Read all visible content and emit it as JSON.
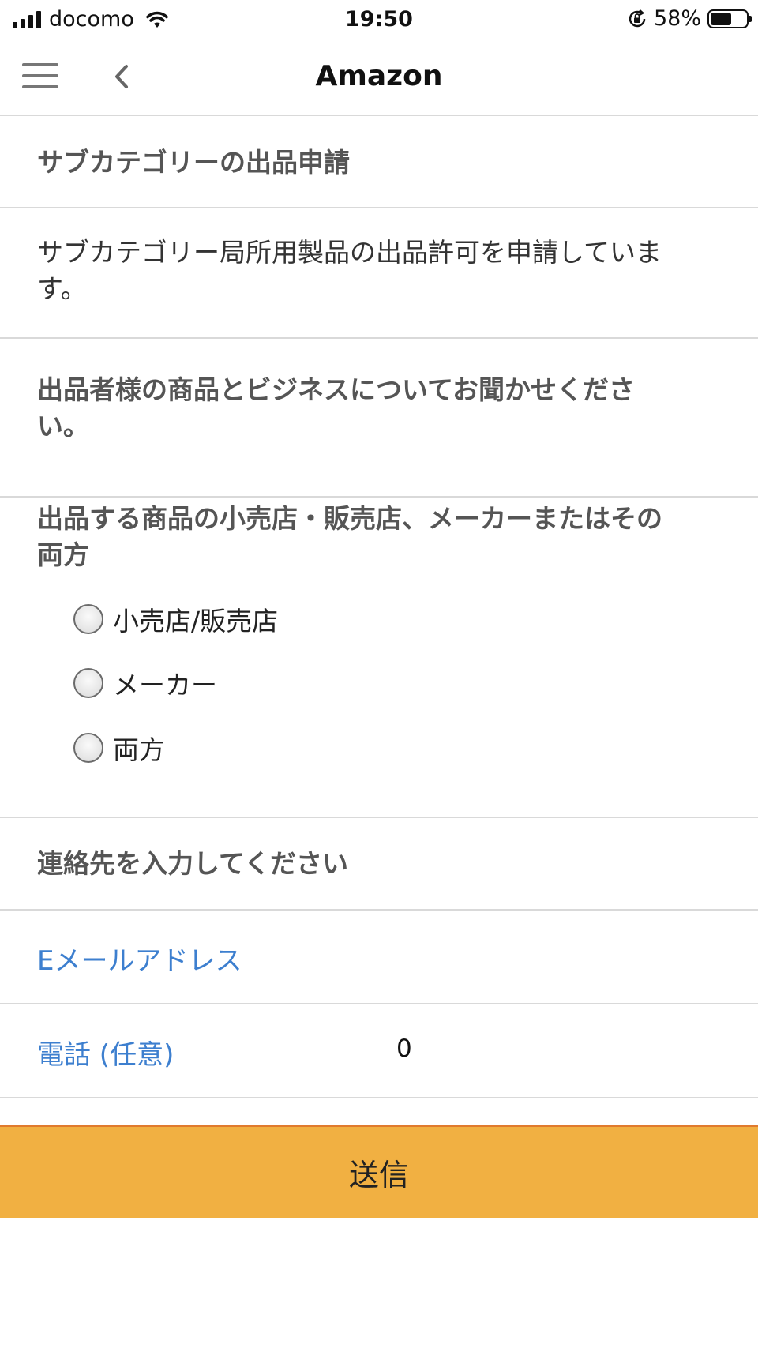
{
  "status_bar": {
    "carrier": "docomo",
    "time": "19:50",
    "battery": "58%"
  },
  "nav": {
    "title": "Amazon"
  },
  "header": {
    "title": "サブカテゴリーの出品申請"
  },
  "intro": {
    "text_line1": "サブカテゴリー局所用製品の出品許可を申請していま",
    "text_line2": "す。"
  },
  "business": {
    "heading_line1": "出品者様の商品とビジネスについてお聞かせくださ",
    "heading_line2": "い。"
  },
  "seller_type": {
    "question_line1": "出品する商品の小売店・販売店、メーカーまたはその",
    "question_line2": "両方",
    "options": [
      {
        "label": "小売店/販売店",
        "selected": false
      },
      {
        "label": "メーカー",
        "selected": false
      },
      {
        "label": "両方",
        "selected": false
      }
    ]
  },
  "contact": {
    "heading": "連絡先を入力してください",
    "email_label": "Eメールアドレス",
    "email_value": "",
    "phone_label": "電話 (任意)",
    "phone_value": "0"
  },
  "submit": {
    "label": "送信"
  },
  "colors": {
    "accent_link": "#3d7fcf",
    "submit_bg": "#f1b042",
    "submit_border": "#e07a2e"
  }
}
